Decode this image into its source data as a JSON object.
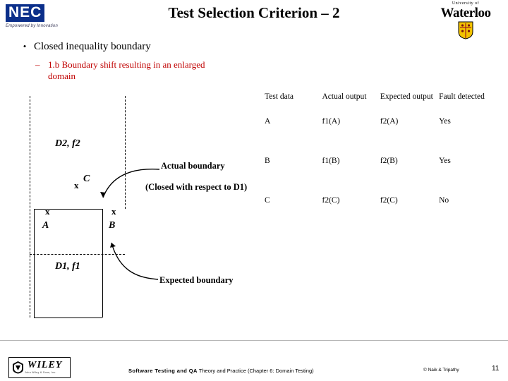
{
  "logos": {
    "nec": {
      "wordmark": "NEC",
      "tagline": "Empowered by Innovation"
    },
    "waterloo": {
      "line1": "University of",
      "line2": "Waterloo",
      "shield_icon": "waterloo-shield-icon"
    },
    "wiley": {
      "wordmark": "WILEY",
      "sub": "John Wiley & Sons, Inc."
    }
  },
  "header": {
    "title": "Test Selection Criterion – 2"
  },
  "bullets": {
    "level1": {
      "marker": "•",
      "text": "Closed inequality boundary"
    },
    "level2": {
      "marker": "–",
      "text": "1.b Boundary shift resulting in an enlarged domain",
      "color": "#c00000"
    }
  },
  "figure": {
    "name": "closed-inequality-boundary-diagram",
    "labels": {
      "d2": "D2, f2",
      "d1": "D1, f1",
      "point_c": "C",
      "point_a": "A",
      "point_b": "B",
      "x_marks": [
        "x",
        "x",
        "x"
      ]
    },
    "captions": {
      "actual": "Actual boundary",
      "actual_sub": "(Closed with respect to D1)",
      "expected": "Expected boundary"
    }
  },
  "table": {
    "headers": [
      "Test data",
      "Actual output",
      "Expected output",
      "Fault detected"
    ],
    "rows": [
      {
        "test_data": "A",
        "actual": "f1(A)",
        "expected": "f2(A)",
        "fault": "Yes"
      },
      {
        "test_data": "B",
        "actual": "f1(B)",
        "expected": "f2(B)",
        "fault": "Yes"
      },
      {
        "test_data": "C",
        "actual": "f2(C)",
        "expected": "f2(C)",
        "fault": "No"
      }
    ]
  },
  "footer": {
    "center_bold": "Software Testing and QA",
    "center_rest": " Theory and Practice (Chapter 6: Domain Testing)",
    "copyright": "© Naik & Tripathy",
    "page_number": "11"
  }
}
